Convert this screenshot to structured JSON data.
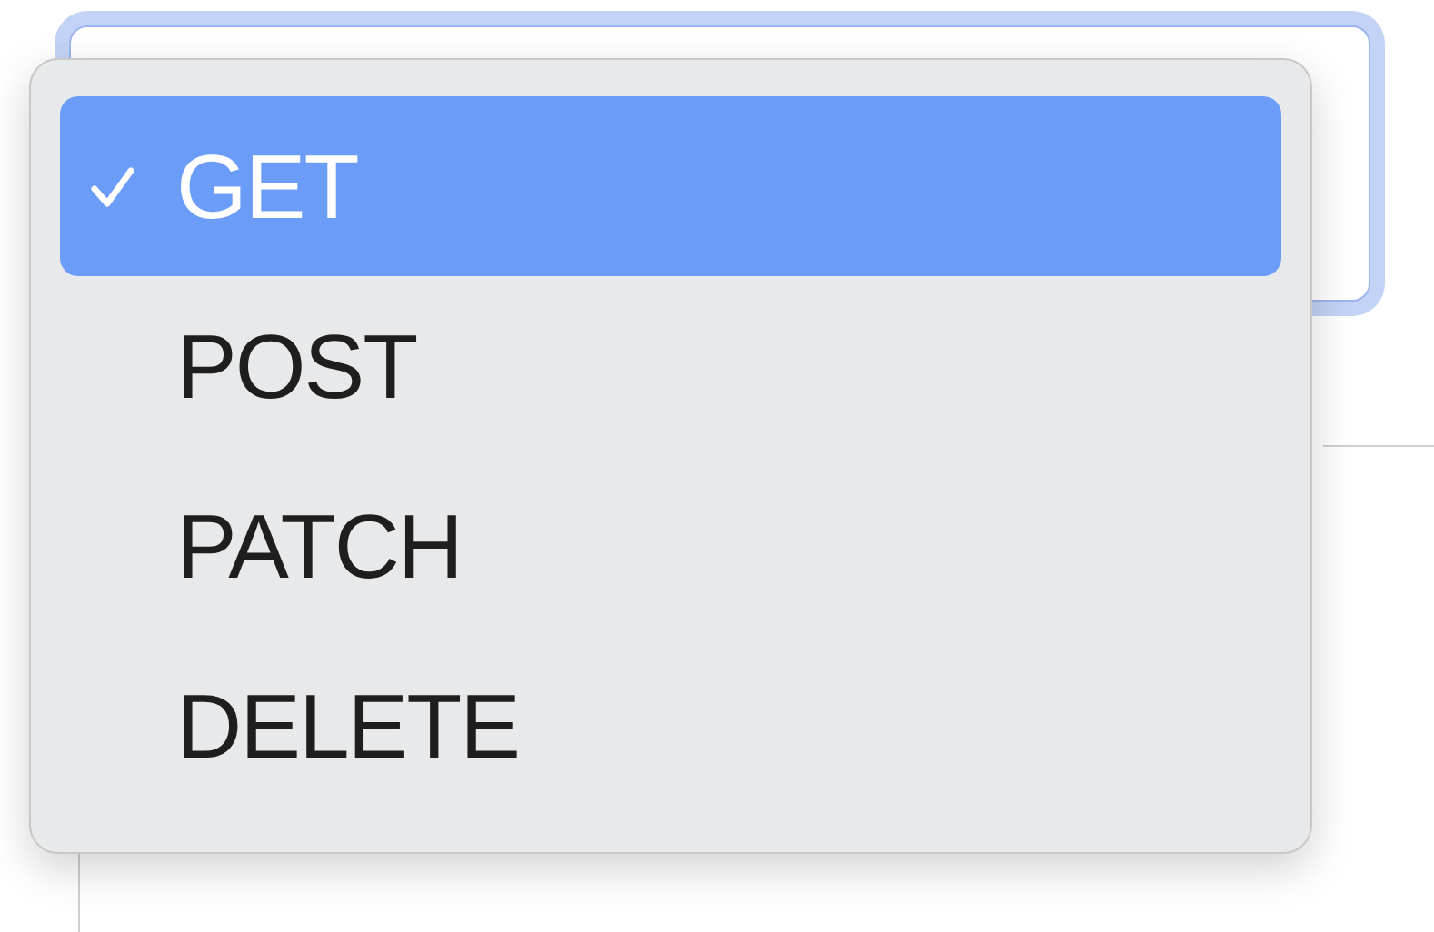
{
  "menu": {
    "items": [
      {
        "label": "GET",
        "selected": true
      },
      {
        "label": "POST",
        "selected": false
      },
      {
        "label": "PATCH",
        "selected": false
      },
      {
        "label": "DELETE",
        "selected": false
      }
    ]
  }
}
